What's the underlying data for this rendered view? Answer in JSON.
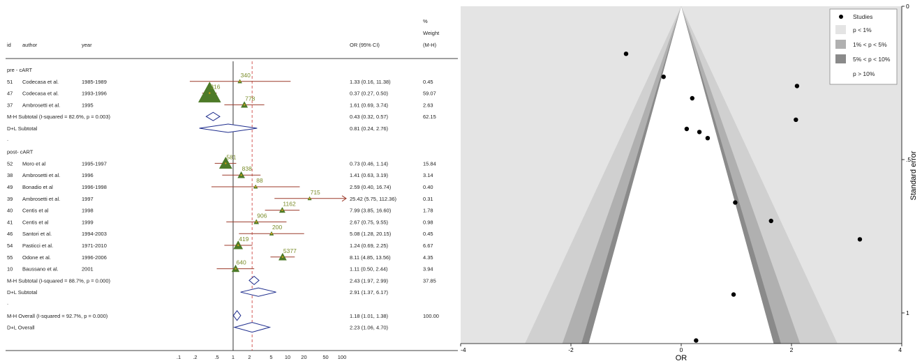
{
  "forest": {
    "headers": {
      "id": "id",
      "author": "author",
      "year": "year",
      "or_ci": "OR (95% CI)",
      "weight_pct": "%",
      "weight_label": "Weight",
      "weight_mh": "(M-H)"
    },
    "groups": [
      {
        "label": "pre - cART",
        "studies": [
          {
            "id": "51",
            "author": "Codecasa et al.",
            "year": "1985-1989",
            "ci_text": "1.33 (0.16, 11.38)",
            "weight": "0.45",
            "or": 1.33,
            "lo": 0.16,
            "hi": 11.38,
            "n": "340"
          },
          {
            "id": "47",
            "author": "Codecasa et al.",
            "year": "1993-1996",
            "ci_text": "0.37 (0.27, 0.50)",
            "weight": "59.07",
            "or": 0.37,
            "lo": 0.27,
            "hi": 0.5,
            "n": "316"
          },
          {
            "id": "37",
            "author": "Ambrosetti et al.",
            "year": "1995",
            "ci_text": "1.61 (0.69, 3.74)",
            "weight": "2.63",
            "or": 1.61,
            "lo": 0.69,
            "hi": 3.74,
            "n": "778"
          }
        ],
        "mh": {
          "label": "M-H Subtotal  (I-squared = 82.6%, p = 0.003)",
          "ci_text": "0.43 (0.32, 0.57)",
          "weight": "62.15",
          "or": 0.43,
          "lo": 0.32,
          "hi": 0.57
        },
        "dl": {
          "label": "D+L Subtotal",
          "ci_text": "0.81 (0.24, 2.76)",
          "weight": "",
          "or": 0.81,
          "lo": 0.24,
          "hi": 2.76
        }
      },
      {
        "label": "post- cART",
        "studies": [
          {
            "id": "52",
            "author": "Moro et al",
            "year": "1995-1997",
            "ci_text": "0.73 (0.46, 1.14)",
            "weight": "15.84",
            "or": 0.73,
            "lo": 0.46,
            "hi": 1.14,
            "n": "581"
          },
          {
            "id": "38",
            "author": "Ambrosetti et al.",
            "year": "1996",
            "ci_text": "1.41 (0.63, 3.19)",
            "weight": "3.14",
            "or": 1.41,
            "lo": 0.63,
            "hi": 3.19,
            "n": "838"
          },
          {
            "id": "49",
            "author": "Bonadio et al",
            "year": "1996-1998",
            "ci_text": "2.59 (0.40, 16.74)",
            "weight": "0.40",
            "or": 2.59,
            "lo": 0.4,
            "hi": 16.74,
            "n": "88"
          },
          {
            "id": "39",
            "author": "Ambrosetti et al.",
            "year": "1997",
            "ci_text": "25.42 (5.75, 112.36)",
            "weight": "0.31",
            "or": 25.42,
            "lo": 5.75,
            "hi": 112.36,
            "n": "715"
          },
          {
            "id": "40",
            "author": "Centis et al",
            "year": "1998",
            "ci_text": "7.99 (3.85, 16.60)",
            "weight": "1.78",
            "or": 7.99,
            "lo": 3.85,
            "hi": 16.6,
            "n": "1162"
          },
          {
            "id": "41",
            "author": "Centis et al",
            "year": "1999",
            "ci_text": "2.67 (0.75, 9.55)",
            "weight": "0.98",
            "or": 2.67,
            "lo": 0.75,
            "hi": 9.55,
            "n": "906"
          },
          {
            "id": "46",
            "author": "Santori et al.",
            "year": "1994-2003",
            "ci_text": "5.08 (1.28, 20.15)",
            "weight": "0.45",
            "or": 5.08,
            "lo": 1.28,
            "hi": 20.15,
            "n": "200"
          },
          {
            "id": "54",
            "author": "Pasticci et al.",
            "year": "1971-2010",
            "ci_text": "1.24 (0.69, 2.25)",
            "weight": "6.67",
            "or": 1.24,
            "lo": 0.69,
            "hi": 2.25,
            "n": "419"
          },
          {
            "id": "55",
            "author": "Odone et al.",
            "year": "1996-2006",
            "ci_text": "8.11 (4.85, 13.56)",
            "weight": "4.35",
            "or": 8.11,
            "lo": 4.85,
            "hi": 13.56,
            "n": "5377"
          },
          {
            "id": "10",
            "author": "Baussano et al.",
            "year": "2001",
            "ci_text": "1.11 (0.50, 2.44)",
            "weight": "3.94",
            "or": 1.11,
            "lo": 0.5,
            "hi": 2.44,
            "n": "640"
          }
        ],
        "mh": {
          "label": "M-H Subtotal  (I-squared = 88.7%, p = 0.000)",
          "ci_text": "2.43 (1.97, 2.99)",
          "weight": "37.85",
          "or": 2.43,
          "lo": 1.97,
          "hi": 2.99
        },
        "dl": {
          "label": "D+L Subtotal",
          "ci_text": "2.91 (1.37, 6.17)",
          "weight": "",
          "or": 2.91,
          "lo": 1.37,
          "hi": 6.17
        }
      }
    ],
    "overall_mh": {
      "label": "M-H Overall  (I-squared = 92.7%, p = 0.000)",
      "ci_text": "1.18 (1.01, 1.38)",
      "weight": "100.00",
      "or": 1.18,
      "lo": 1.01,
      "hi": 1.38
    },
    "overall_dl": {
      "label": "D+L Overall",
      "ci_text": "2.23 (1.06, 4.70)",
      "weight": "",
      "or": 2.23,
      "lo": 1.06,
      "hi": 4.7
    },
    "separator_dot": ".",
    "x_ticks": [
      {
        "label": ".1",
        "value": 0.1
      },
      {
        "label": ".2",
        "value": 0.2
      },
      {
        "label": ".5",
        "value": 0.5
      },
      {
        "label": "1",
        "value": 1
      },
      {
        "label": "2",
        "value": 2
      },
      {
        "label": "5",
        "value": 5
      },
      {
        "label": "10",
        "value": 10
      },
      {
        "label": "20",
        "value": 20
      },
      {
        "label": "50",
        "value": 50
      },
      {
        "label": "100",
        "value": 100
      }
    ],
    "colors": {
      "study_line": "#9c3a2a",
      "box": "#4d7a28",
      "box_label": "#7a8c2a",
      "diamond": "#1c2b8c",
      "point": "#d4a017"
    }
  },
  "funnel": {
    "xlabel": "OR",
    "ylabel": "Standard error",
    "xlim": [
      -4,
      4
    ],
    "ylim": [
      0,
      1.1
    ],
    "x_ticks": [
      {
        "label": "-4",
        "value": -4
      },
      {
        "label": "-2",
        "value": -2
      },
      {
        "label": "0",
        "value": 0
      },
      {
        "label": "2",
        "value": 2
      },
      {
        "label": "4",
        "value": 4
      }
    ],
    "y_ticks": [
      {
        "label": "0",
        "value": 0
      },
      {
        "label": ".5",
        "value": 0.5
      },
      {
        "label": "1",
        "value": 1
      }
    ],
    "legend": {
      "studies": "Studies",
      "p1": "p < 1%",
      "p5": "1% < p < 5%",
      "p10": "5% < p < 10%",
      "pgt": "p > 10%"
    },
    "colors": {
      "outer": "#e4e4e4",
      "p1": "#d0d0d0",
      "p5": "#b0b0b0",
      "p10": "#8a8a8a",
      "inner": "#ffffff",
      "dot": "#000000"
    }
  },
  "chart_data": [
    {
      "type": "scatter",
      "title": "",
      "xlabel": "",
      "ylabel": "OR (95% CI)",
      "x_scale": "log",
      "categories": [
        "Codecasa et al. 1985-1989",
        "Codecasa et al. 1993-1996",
        "Ambrosetti et al. 1995",
        "M-H Subtotal pre - cART",
        "D+L Subtotal pre - cART",
        "Moro et al 1995-1997",
        "Ambrosetti et al. 1996",
        "Bonadio et al 1996-1998",
        "Ambrosetti et al. 1997",
        "Centis et al 1998",
        "Centis et al 1999",
        "Santori et al. 1994-2003",
        "Pasticci et al. 1971-2010",
        "Odone et al. 1996-2006",
        "Baussano et al. 2001",
        "M-H Subtotal post- cART",
        "D+L Subtotal post- cART",
        "M-H Overall",
        "D+L Overall"
      ],
      "series": [
        {
          "name": "OR",
          "values": [
            1.33,
            0.37,
            1.61,
            0.43,
            0.81,
            0.73,
            1.41,
            2.59,
            25.42,
            7.99,
            2.67,
            5.08,
            1.24,
            8.11,
            1.11,
            2.43,
            2.91,
            1.18,
            2.23
          ]
        },
        {
          "name": "95% CI lower",
          "values": [
            0.16,
            0.27,
            0.69,
            0.32,
            0.24,
            0.46,
            0.63,
            0.4,
            5.75,
            3.85,
            0.75,
            1.28,
            0.69,
            4.85,
            0.5,
            1.97,
            1.37,
            1.01,
            1.06
          ]
        },
        {
          "name": "95% CI upper",
          "values": [
            11.38,
            0.5,
            3.74,
            0.57,
            2.76,
            1.14,
            3.19,
            16.74,
            112.36,
            16.6,
            9.55,
            20.15,
            2.25,
            13.56,
            2.44,
            2.99,
            6.17,
            1.38,
            4.7
          ]
        },
        {
          "name": "Weight",
          "values": [
            0.45,
            59.07,
            2.63,
            62.15,
            null,
            15.84,
            3.14,
            0.4,
            0.31,
            1.78,
            0.98,
            0.45,
            6.67,
            4.35,
            3.94,
            37.85,
            null,
            100.0,
            null
          ]
        }
      ]
    },
    {
      "type": "scatter",
      "title": "",
      "xlabel": "OR",
      "ylabel": "Standard error",
      "xlim": [
        -4,
        4
      ],
      "ylim": [
        0,
        1.1
      ],
      "y_reversed": true,
      "series": [
        {
          "name": "Studies",
          "points": [
            {
              "x": -1.0,
              "y": 0.155
            },
            {
              "x": -0.32,
              "y": 0.23
            },
            {
              "x": 0.2,
              "y": 0.3
            },
            {
              "x": 2.1,
              "y": 0.26
            },
            {
              "x": 2.08,
              "y": 0.37
            },
            {
              "x": 0.1,
              "y": 0.4
            },
            {
              "x": 0.33,
              "y": 0.41
            },
            {
              "x": 0.48,
              "y": 0.43
            },
            {
              "x": 0.98,
              "y": 0.64
            },
            {
              "x": 1.63,
              "y": 0.7
            },
            {
              "x": 3.24,
              "y": 0.76
            },
            {
              "x": 0.95,
              "y": 0.94
            },
            {
              "x": 0.27,
              "y": 1.09
            }
          ]
        }
      ]
    }
  ]
}
